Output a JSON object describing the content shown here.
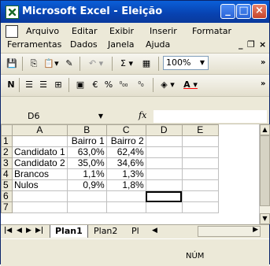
{
  "window": {
    "title": "Microsoft Excel - Eleição"
  },
  "menu": {
    "row1": [
      "Arquivo",
      "Editar",
      "Exibir",
      "Inserir",
      "Formatar"
    ],
    "row2": [
      "Ferramentas",
      "Dados",
      "Janela",
      "Ajuda"
    ]
  },
  "toolbar": {
    "zoom": "100%"
  },
  "formula": {
    "name_box": "D6",
    "fx": "fx",
    "content": ""
  },
  "sheet": {
    "columns": [
      "A",
      "B",
      "C",
      "D",
      "E"
    ],
    "rows": [
      {
        "n": "1",
        "cells": [
          "",
          "Bairro 1",
          "Bairro 2",
          "",
          ""
        ]
      },
      {
        "n": "2",
        "cells": [
          "Candidato 1",
          "63,0%",
          "62,4%",
          "",
          ""
        ]
      },
      {
        "n": "3",
        "cells": [
          "Candidato 2",
          "35,0%",
          "34,6%",
          "",
          ""
        ]
      },
      {
        "n": "4",
        "cells": [
          "Brancos",
          "1,1%",
          "1,3%",
          "",
          ""
        ]
      },
      {
        "n": "5",
        "cells": [
          "Nulos",
          "0,9%",
          "1,8%",
          "",
          ""
        ]
      },
      {
        "n": "6",
        "cells": [
          "",
          "",
          "",
          "",
          ""
        ]
      },
      {
        "n": "7",
        "cells": [
          "",
          "",
          "",
          "",
          ""
        ]
      }
    ]
  },
  "tabs": [
    "Plan1",
    "Plan2",
    "Pl"
  ],
  "status": {
    "mode": "NÚM"
  }
}
